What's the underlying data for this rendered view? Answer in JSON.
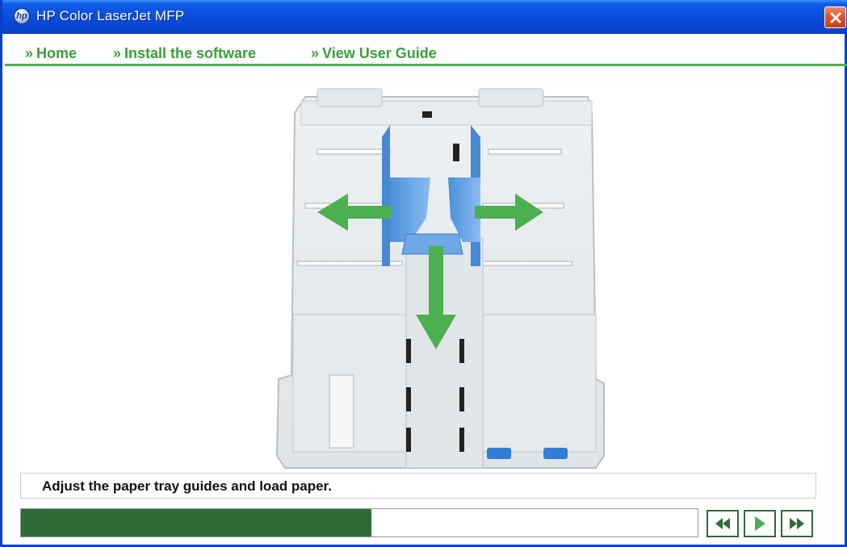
{
  "window": {
    "title": "HP Color LaserJet MFP",
    "icon": "hp-logo-icon",
    "close_icon": "close-icon",
    "titlebar_color": "#0a4fdc",
    "close_color": "#e0552c"
  },
  "nav": {
    "prefix": "»",
    "items": [
      {
        "label": "Home"
      },
      {
        "label": "Install the software"
      },
      {
        "label": "View User Guide"
      }
    ],
    "accent_color": "#3aa03a"
  },
  "illustration": {
    "subject": "paper-tray",
    "arrow_color": "#4caf50",
    "guide_color": "#6fa8e6"
  },
  "caption": {
    "text": "Adjust the paper tray guides and load paper."
  },
  "progress": {
    "fraction": 0.518,
    "fill_color": "#2f6b36"
  },
  "controls": {
    "rewind_icon": "rewind-icon",
    "play_icon": "play-icon",
    "fast_forward_icon": "fast-forward-icon"
  }
}
